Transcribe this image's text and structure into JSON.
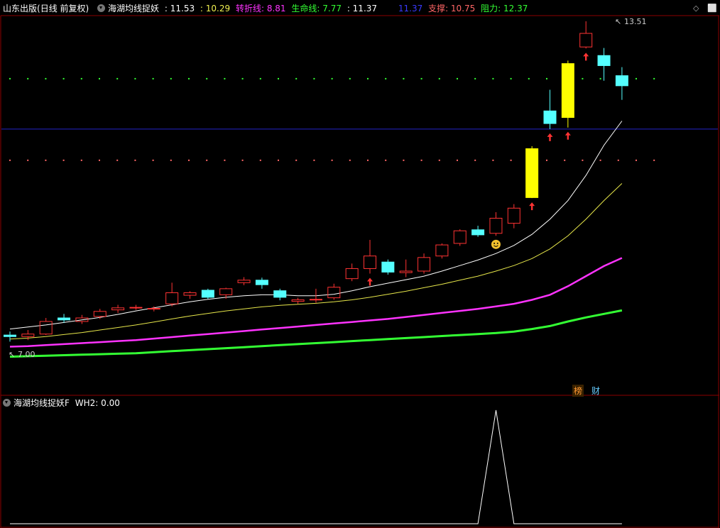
{
  "header": {
    "stock": "山东出版",
    "period": "(日线 前复权)",
    "indicator": "海湖均线捉妖",
    "v1": ": 11.53",
    "v2": ": 10.29",
    "turn_label": "转折线",
    "turn_value": ": 8.81",
    "life_label": "生命线",
    "life_value": ": 7.77",
    "v5": ": 11.37",
    "v6": "11.37",
    "support_label": "支撑",
    "support_value": ": 10.75",
    "resist_label": "阻力",
    "resist_value": ": 12.37"
  },
  "annotations": {
    "high": "13.51",
    "low": "7.00"
  },
  "badges": {
    "rank": "榜",
    "fin": "财"
  },
  "sub_panel": {
    "title": "海湖均线捉妖F",
    "label": "WH2",
    "value": ": 0.00"
  },
  "colors": {
    "up": "#ff3333",
    "down": "#54ffff",
    "limit_up": "#ffff00",
    "ma_fast": "#ffffff",
    "ma_mid": "#e6e64a",
    "turn": "#ff33ff",
    "life": "#33ff33",
    "support_dots": "#ff6666",
    "resist_dots": "#33ff33",
    "blue_line": "#2323c8"
  },
  "price_scale": {
    "max": 13.51,
    "min": 7.0
  },
  "candles": [
    [
      7.28,
      7.25,
      7.35,
      7.15
    ],
    [
      7.25,
      7.3,
      7.38,
      7.18
    ],
    [
      7.3,
      7.55,
      7.62,
      7.28
    ],
    [
      7.62,
      7.58,
      7.7,
      7.52
    ],
    [
      7.55,
      7.62,
      7.68,
      7.5
    ],
    [
      7.65,
      7.75,
      7.8,
      7.6
    ],
    [
      7.78,
      7.82,
      7.88,
      7.72
    ],
    [
      7.82,
      7.83,
      7.88,
      7.78
    ],
    [
      7.8,
      7.81,
      7.85,
      7.75
    ],
    [
      7.9,
      8.12,
      8.32,
      7.85
    ],
    [
      8.07,
      8.12,
      8.15,
      8.0
    ],
    [
      8.17,
      8.03,
      8.2,
      8.0
    ],
    [
      8.08,
      8.2,
      8.22,
      8.0
    ],
    [
      8.32,
      8.37,
      8.43,
      8.27
    ],
    [
      8.37,
      8.28,
      8.42,
      8.2
    ],
    [
      8.16,
      8.03,
      8.2,
      7.97
    ],
    [
      7.95,
      7.98,
      8.02,
      7.9
    ],
    [
      7.98,
      7.99,
      8.2,
      7.92
    ],
    [
      8.02,
      8.23,
      8.3,
      7.98
    ],
    [
      8.4,
      8.6,
      8.7,
      8.35
    ],
    [
      8.6,
      8.85,
      9.17,
      8.5
    ],
    [
      8.73,
      8.53,
      8.78,
      8.48
    ],
    [
      8.52,
      8.55,
      8.78,
      8.43
    ],
    [
      8.55,
      8.82,
      8.9,
      8.5
    ],
    [
      8.85,
      9.07,
      9.1,
      8.8
    ],
    [
      9.1,
      9.35,
      9.38,
      9.05
    ],
    [
      9.37,
      9.27,
      9.45,
      9.23
    ],
    [
      9.3,
      9.6,
      9.72,
      9.25
    ],
    [
      9.5,
      9.8,
      9.88,
      9.4
    ],
    [
      10.01,
      10.98,
      11.03,
      10.0
    ],
    [
      11.73,
      11.48,
      12.15,
      11.37
    ],
    [
      11.6,
      12.67,
      12.73,
      11.4
    ],
    [
      13.0,
      13.27,
      13.51,
      12.97
    ],
    [
      12.83,
      12.63,
      12.98,
      12.33
    ],
    [
      12.43,
      12.23,
      12.6,
      11.95
    ]
  ],
  "ma_fast": [
    7.4,
    7.44,
    7.48,
    7.53,
    7.58,
    7.63,
    7.69,
    7.76,
    7.82,
    7.88,
    7.94,
    7.99,
    8.03,
    8.06,
    8.08,
    8.08,
    8.06,
    8.06,
    8.09,
    8.16,
    8.24,
    8.31,
    8.38,
    8.45,
    8.55,
    8.66,
    8.77,
    8.9,
    9.06,
    9.28,
    9.58,
    9.95,
    10.45,
    11.05,
    11.53
  ],
  "ma_mid": [
    7.2,
    7.22,
    7.25,
    7.29,
    7.33,
    7.38,
    7.43,
    7.48,
    7.54,
    7.6,
    7.66,
    7.71,
    7.76,
    7.8,
    7.84,
    7.87,
    7.89,
    7.91,
    7.94,
    7.98,
    8.03,
    8.09,
    8.15,
    8.22,
    8.29,
    8.37,
    8.45,
    8.55,
    8.66,
    8.8,
    8.99,
    9.25,
    9.58,
    9.95,
    10.29
  ],
  "turn": [
    7.05,
    7.06,
    7.08,
    7.1,
    7.12,
    7.14,
    7.16,
    7.18,
    7.21,
    7.24,
    7.27,
    7.3,
    7.33,
    7.36,
    7.39,
    7.42,
    7.45,
    7.48,
    7.51,
    7.54,
    7.57,
    7.6,
    7.64,
    7.68,
    7.72,
    7.76,
    7.8,
    7.85,
    7.9,
    7.98,
    8.08,
    8.25,
    8.45,
    8.65,
    8.81
  ],
  "life": [
    6.85,
    6.86,
    6.87,
    6.88,
    6.89,
    6.9,
    6.91,
    6.92,
    6.94,
    6.96,
    6.98,
    7.0,
    7.02,
    7.04,
    7.06,
    7.08,
    7.1,
    7.12,
    7.14,
    7.16,
    7.18,
    7.2,
    7.22,
    7.24,
    7.26,
    7.28,
    7.3,
    7.32,
    7.35,
    7.4,
    7.46,
    7.55,
    7.63,
    7.7,
    7.77
  ],
  "up_arrows": [
    20,
    29,
    30,
    31,
    32
  ],
  "smiley_index": 27,
  "wh2": [
    0,
    0,
    0,
    0,
    0,
    0,
    0,
    0,
    0,
    0,
    0,
    0,
    0,
    0,
    0,
    0,
    0,
    0,
    0,
    0,
    0,
    0,
    0,
    0,
    0,
    0,
    0,
    1,
    0,
    0,
    0,
    0,
    0,
    0,
    0
  ]
}
